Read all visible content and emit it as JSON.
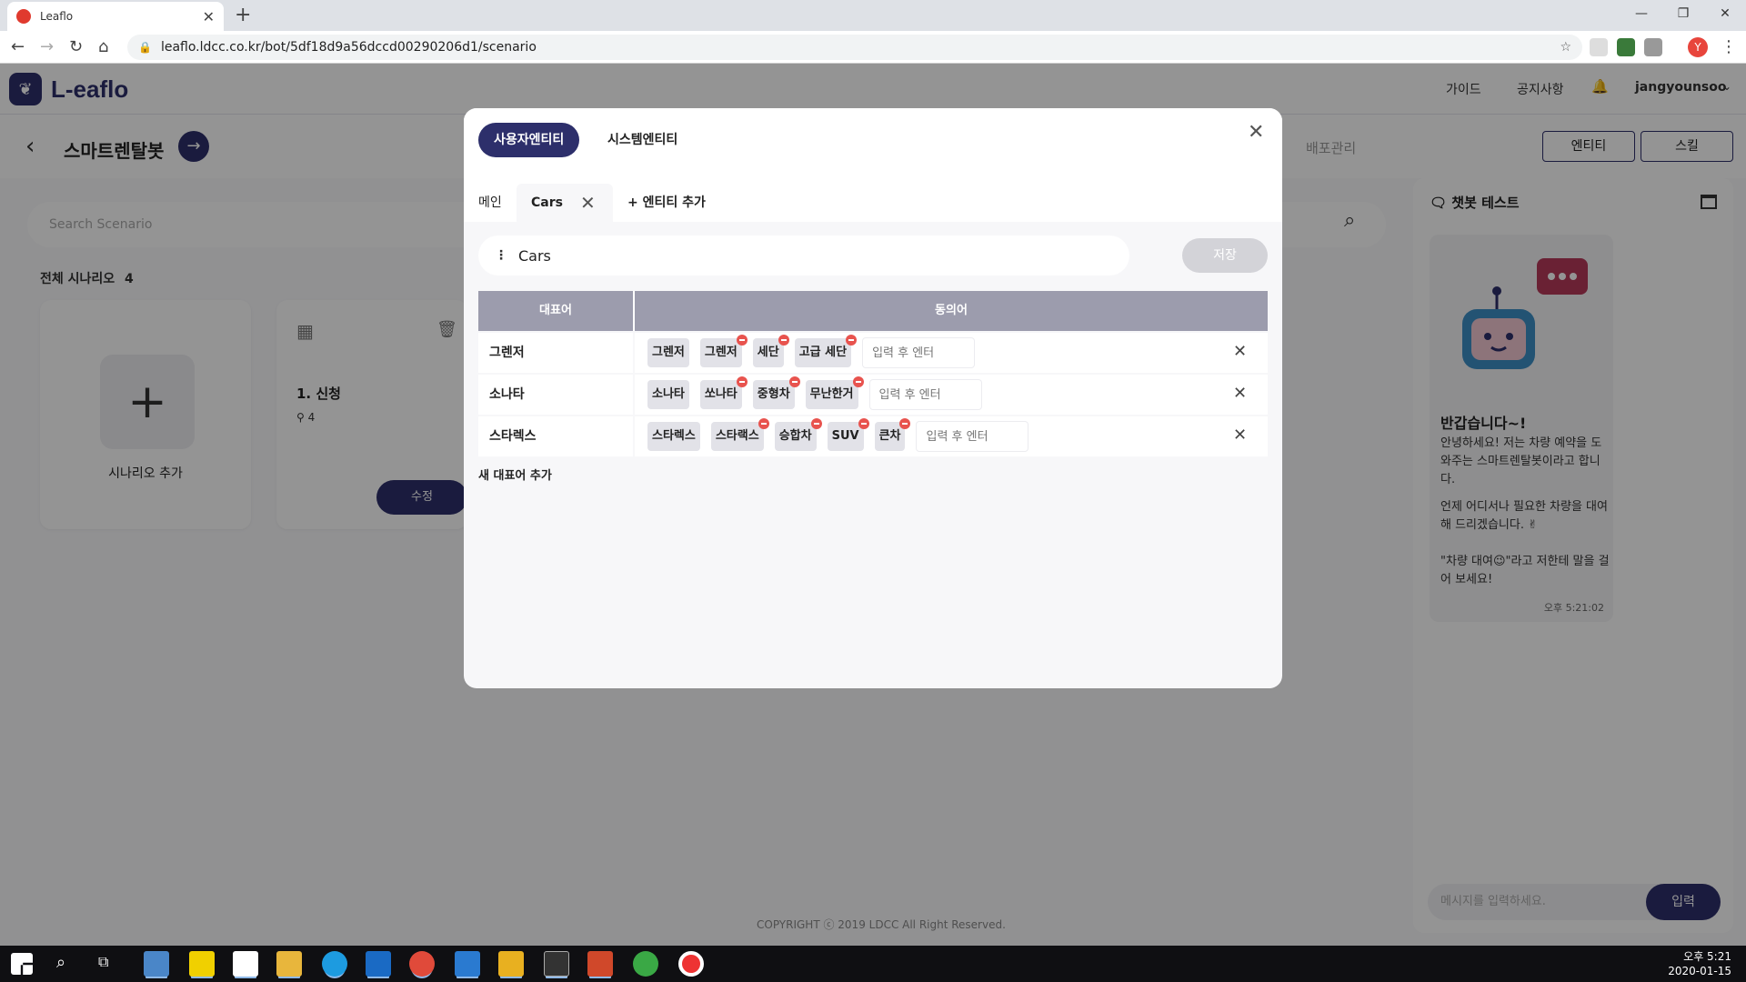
{
  "browser": {
    "tab_title": "Leaflo",
    "new_tab": "+",
    "url": "leaflo.ldcc.co.kr/bot/5df18d9a56dccd00290206d1/scenario",
    "profile_initial": "Y",
    "window_controls": [
      "—",
      "❐",
      "✕"
    ]
  },
  "app": {
    "logo_text": "L-eaflo",
    "nav": {
      "guide": "가이드",
      "notice": "공지사항",
      "user": "jangyounsoo"
    },
    "bot_name": "스마트렌탈봇",
    "deploy": "배포관리",
    "entity_button": "엔티티",
    "skill_button": "스킬",
    "search_placeholder": "Search Scenario",
    "scenario_count_label": "전체 시나리오",
    "scenario_count": "4",
    "add_scenario": "시나리오 추가",
    "scenario_card_title": "1. 신청",
    "scenario_card_count": "4",
    "edit_button": "수정",
    "copyright": "COPYRIGHT ⓒ 2019 LDCC All Right Reserved."
  },
  "chat": {
    "title": "챗봇 테스트",
    "greeting": "반갑습니다~!",
    "message1": "안녕하세요! 저는 차량 예약을 도와주는 스마트렌탈봇이라고 합니다.",
    "message2": "언제 어디서나 필요한 차량을 대여해 드리겠습니다. ✌",
    "message3": "\"차량 대여😉\"라고 저한테 말을 걸어 보세요!",
    "time": "오후 5:21:02",
    "input_placeholder": "메시지를 입력하세요.",
    "send_label": "입력"
  },
  "modal": {
    "tab_user_entity": "사용자엔티티",
    "tab_system_entity": "시스템엔티티",
    "entity_tab_main": "메인",
    "entity_tab_cars": "Cars",
    "add_entity": "+ 엔티티 추가",
    "entity_name": "Cars",
    "save_label": "저장",
    "col_representative": "대표어",
    "col_synonyms": "동의어",
    "synonym_placeholder": "입력 후 엔터",
    "add_representative": "새 대표어 추가",
    "rows": [
      {
        "rep": "그렌저",
        "synonyms": [
          {
            "t": "그렌저",
            "removable": false
          },
          {
            "t": "그렌저",
            "removable": true
          },
          {
            "t": "세단",
            "removable": true
          },
          {
            "t": "고급 세단",
            "removable": true
          }
        ]
      },
      {
        "rep": "소나타",
        "synonyms": [
          {
            "t": "소나타",
            "removable": false
          },
          {
            "t": "쏘나타",
            "removable": true
          },
          {
            "t": "중형차",
            "removable": true
          },
          {
            "t": "무난한거",
            "removable": true
          }
        ]
      },
      {
        "rep": "스타렉스",
        "synonyms": [
          {
            "t": "스타렉스",
            "removable": false
          },
          {
            "t": "스타랙스",
            "removable": true
          },
          {
            "t": "승합차",
            "removable": true
          },
          {
            "t": "SUV",
            "removable": true
          },
          {
            "t": "큰차",
            "removable": true
          }
        ]
      }
    ]
  },
  "taskbar": {
    "time": "오후 5:21",
    "date": "2020-01-15"
  },
  "colors": {
    "brand": "#2d2f6b",
    "table_header": "#9c9cad",
    "remove": "#e8534e"
  }
}
